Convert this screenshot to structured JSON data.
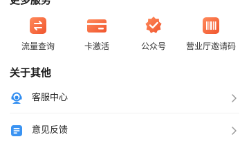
{
  "more_services": {
    "title": "更多服务",
    "items": [
      {
        "label": "流量查询",
        "icon": "traffic-query-icon",
        "color": "#f4643c"
      },
      {
        "label": "卡激活",
        "icon": "card-activation-icon",
        "color": "#f4643c"
      },
      {
        "label": "公众号",
        "icon": "official-account-badge-icon",
        "color": "#f4643c"
      },
      {
        "label": "营业厅邀请码",
        "icon": "invite-code-icon",
        "color": "#f4643c"
      }
    ]
  },
  "about": {
    "title": "关于其他",
    "items": [
      {
        "label": "客服中心",
        "icon": "customer-service-icon",
        "color": "#2f8cf0"
      },
      {
        "label": "意见反馈",
        "icon": "feedback-icon",
        "color": "#2f8cf0"
      }
    ]
  }
}
